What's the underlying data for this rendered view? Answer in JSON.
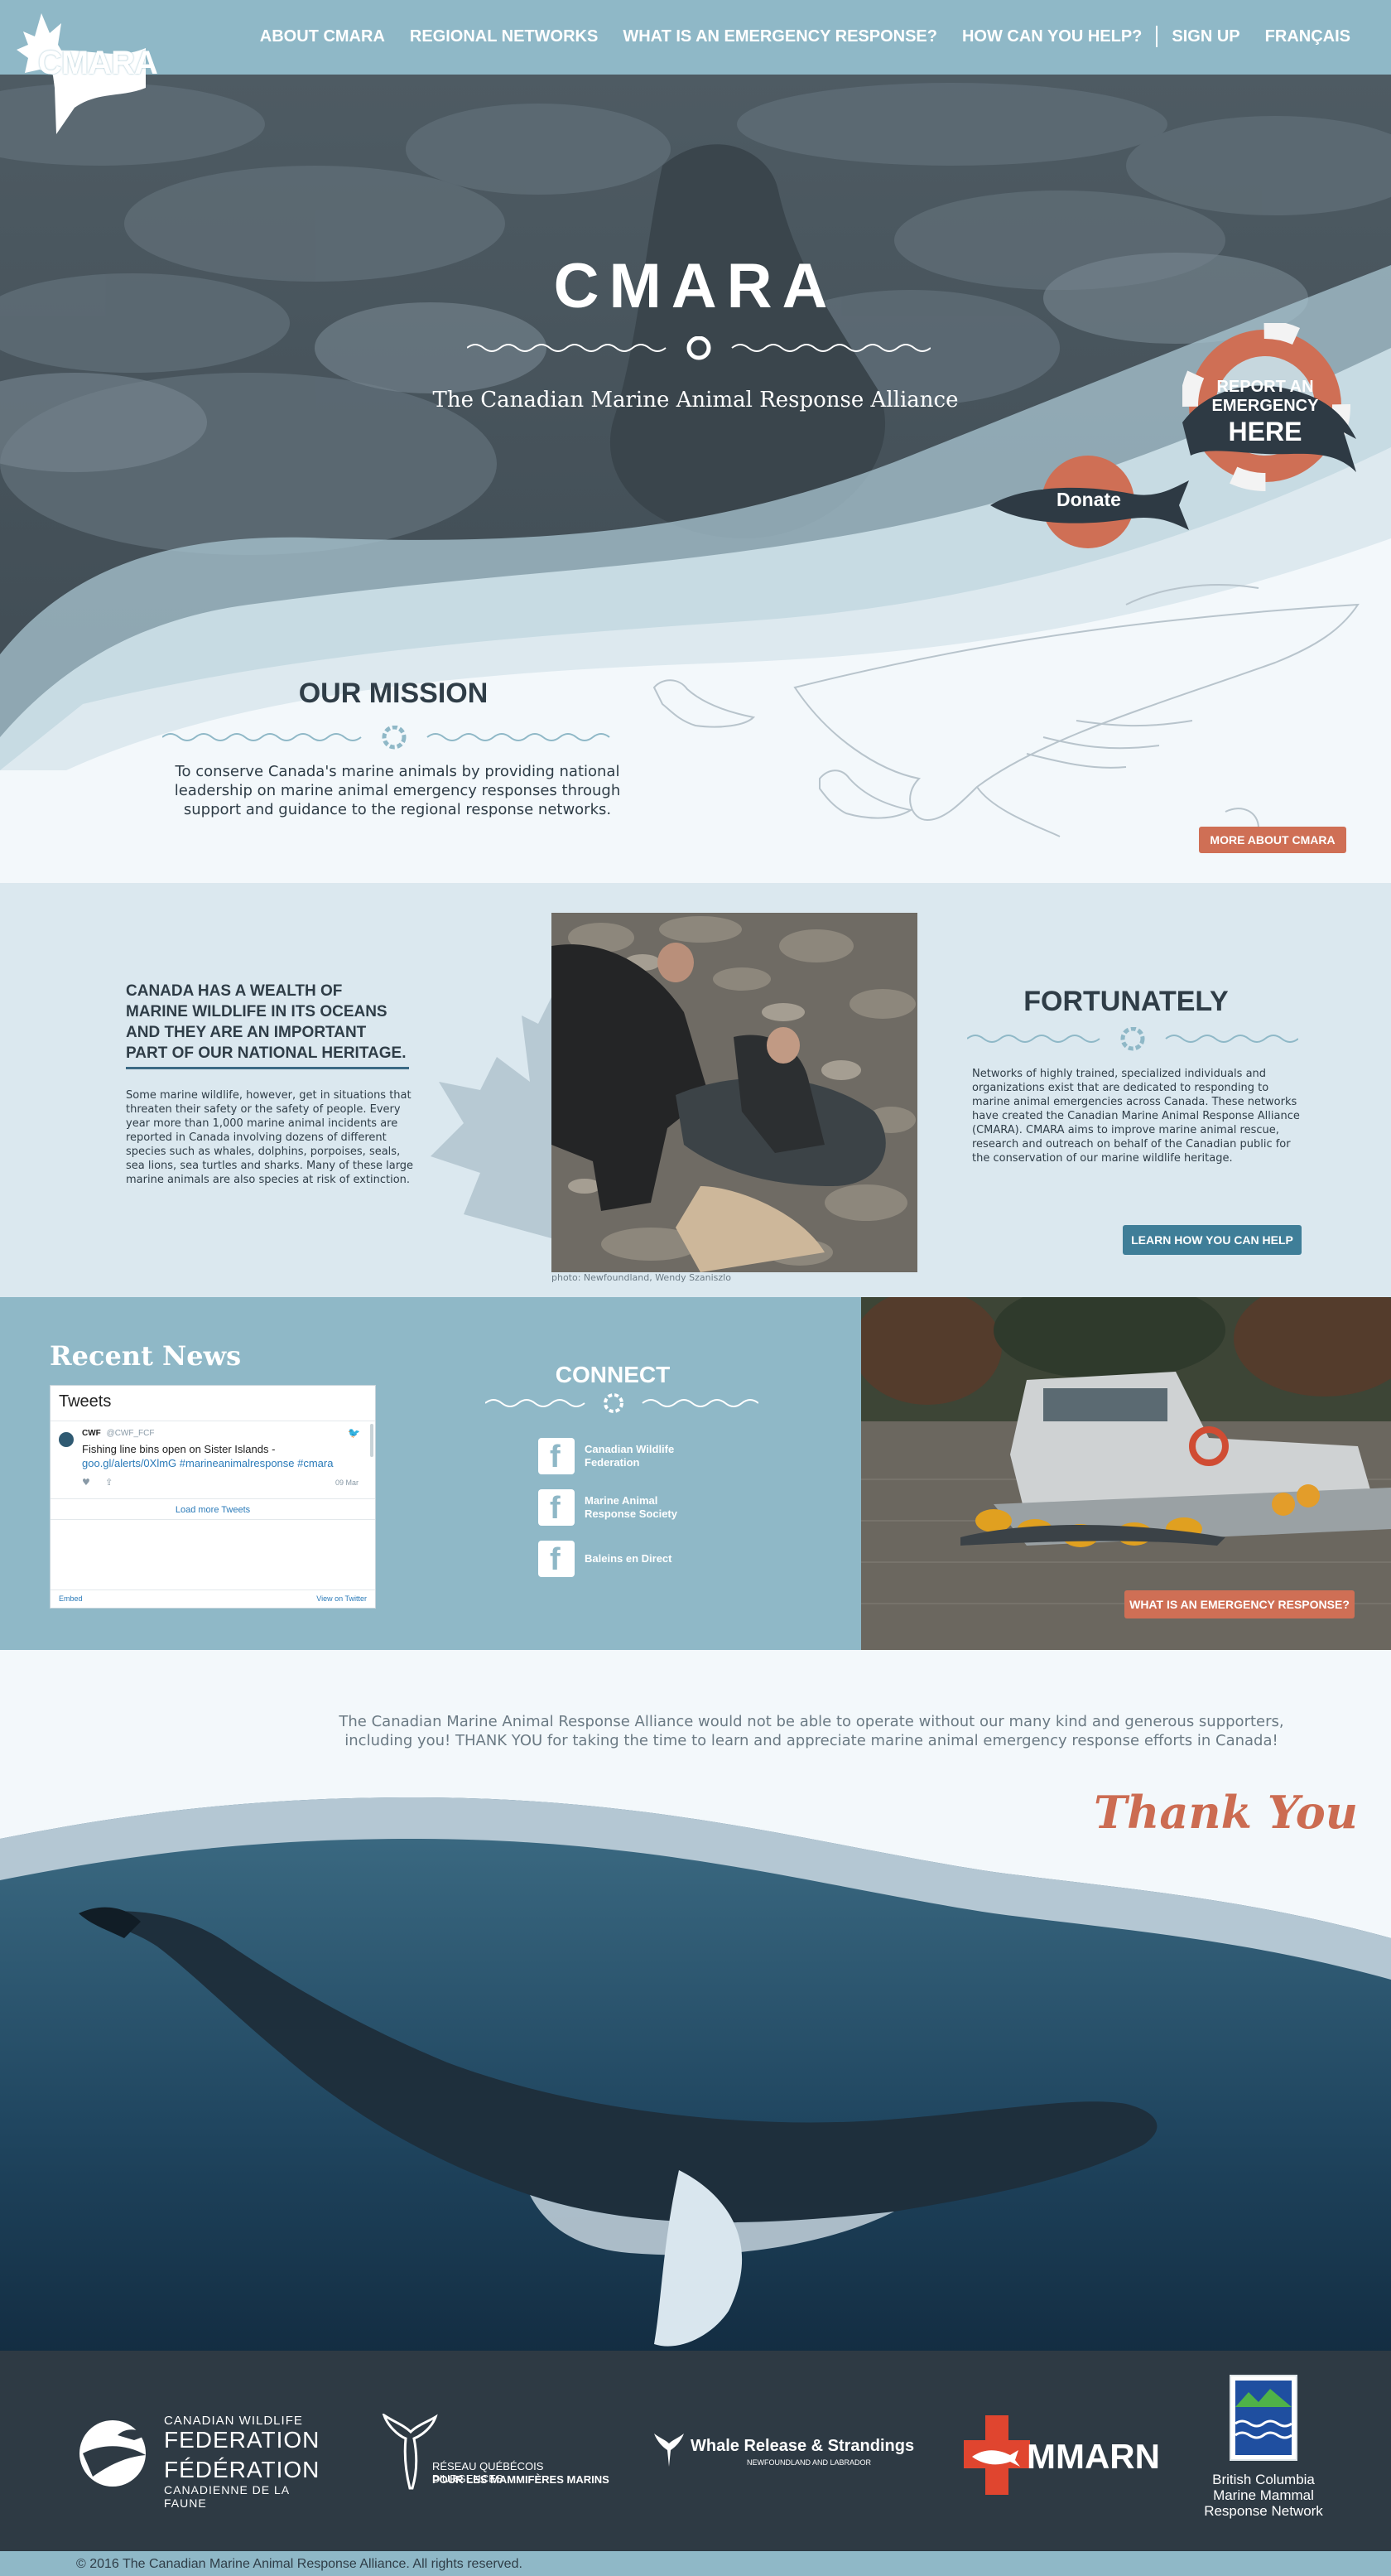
{
  "brand": {
    "logo_text": "CMARA",
    "colors": {
      "nav": "#8fb8c7",
      "accent": "#cf6f55",
      "dark": "#2f3d47",
      "button_blue": "#3f7e98"
    }
  },
  "nav": {
    "items": [
      "ABOUT CMARA",
      "REGIONAL NETWORKS",
      "WHAT IS AN EMERGENCY RESPONSE?",
      "HOW CAN YOU HELP?",
      "SIGN UP",
      "FRANÇAIS"
    ]
  },
  "hero": {
    "title": "CMARA",
    "subtitle": "The Canadian Marine Animal Response Alliance",
    "report": {
      "line1": "REPORT AN",
      "line2": "EMERGENCY",
      "line3": "HERE"
    },
    "donate_label": "Donate"
  },
  "mission": {
    "title": "OUR MISSION",
    "text": "To conserve Canada's marine animals by providing national leadership on marine animal emergency responses through support and guidance to the regional response networks.",
    "more_button": "MORE ABOUT CMARA"
  },
  "heritage": {
    "heading": "CANADA HAS A WEALTH OF MARINE WILDLIFE IN ITS OCEANS AND THEY ARE AN IMPORTANT PART OF OUR NATIONAL HERITAGE.",
    "body": "Some marine wildlife, however, get in situations that threaten their safety or the safety of people. Every year more than 1,000 marine animal incidents are reported in Canada involving dozens of different species such as whales, dolphins, porpoises, seals, sea lions, sea turtles and sharks. Many of these large marine animals are also species at risk of extinction.",
    "photo_credit": "photo: Newfoundland, Wendy Szaniszlo",
    "fortunately_title": "FORTUNATELY",
    "fortunately_body": "Networks of highly trained, specialized individuals and organizations exist that are dedicated to responding to marine animal emergencies across Canada. These networks have created the Canadian Marine Animal Response Alliance (CMARA). CMARA aims to improve marine animal rescue, research and outreach on behalf of the Canadian public for the conservation of our marine wildlife heritage.",
    "learn_button": "LEARN HOW YOU CAN HELP"
  },
  "news": {
    "title": "Recent News",
    "tweets_header": "Tweets",
    "tweet": {
      "user": "CWF",
      "handle": "@CWF_FCF",
      "text_plain": "Fishing line bins open on Sister Islands -",
      "text_link": "goo.gl/alerts/0XlmG #marineanimalresponse #cmara",
      "date": "09 Mar"
    },
    "load_more": "Load more Tweets",
    "embed": "Embed",
    "view_on_twitter": "View on Twitter"
  },
  "connect": {
    "title": "CONNECT",
    "links": [
      "Canadian Wildlife Federation",
      "Marine Animal Response Society",
      "Baleins en Direct"
    ]
  },
  "emergency_button": "WHAT IS AN EMERGENCY RESPONSE?",
  "thanks": {
    "text": "The Canadian Marine Animal Response Alliance would not be able to operate without our many kind and generous supporters, including you! THANK YOU for taking the time to learn and appreciate marine animal emergency response efforts in Canada!",
    "signature": "Thank You"
  },
  "partners": {
    "cwf": {
      "line1": "CANADIAN WILDLIFE",
      "line2": "FEDERATION",
      "line3": "FÉDÉRATION",
      "line4": "CANADIENNE DE LA FAUNE"
    },
    "rqumm": {
      "line1": "RÉSEAU QUÉBÉCOIS D'URGENCES",
      "line2": "POUR LES MAMMIFÈRES MARINS"
    },
    "whale_release": {
      "line1": "Whale Release & Strandings",
      "line2": "NEWFOUNDLAND AND LABRADOR"
    },
    "mmarn": {
      "text": "MMARN"
    },
    "bc": {
      "line1": "British Columbia",
      "line2": "Marine Mammal",
      "line3": "Response Network"
    }
  },
  "copyright": "© 2016 The Canadian Marine Animal Response Alliance. All rights reserved."
}
